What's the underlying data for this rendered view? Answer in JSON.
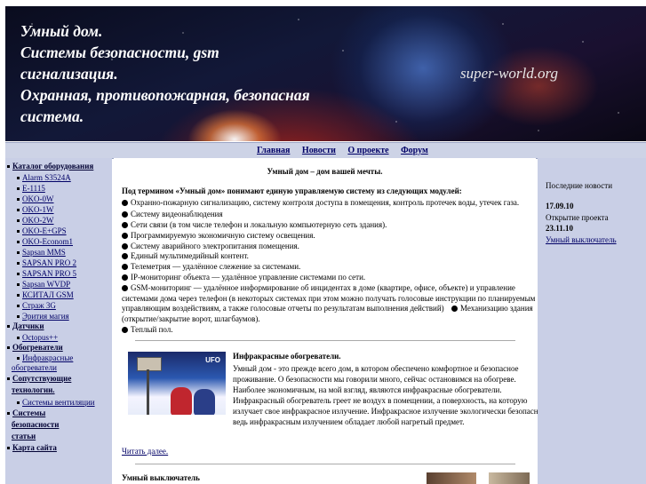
{
  "header": {
    "title_lines": [
      "Умный дом.",
      "Системы безопасности, gsm",
      "сигнализация.",
      "Охранная, противопожарная, безопасная",
      "система."
    ],
    "site": "super-world.org"
  },
  "nav": {
    "items": [
      "Главная",
      "Новости",
      "О проекте",
      "Форум"
    ]
  },
  "sidebar": {
    "catalog_title": "Каталог оборудования",
    "catalog_items": [
      "Alarm S3524A",
      "E-1115",
      "OKO-0W",
      "OKO-1W",
      "OKO-2W",
      "OKO-E+GPS",
      "OKO-Econom1",
      "Sapsan MMS",
      "SAPSAN PRO 2",
      "SAPSAN PRO 5",
      "Sapsan WVDP",
      "КСИТАЛ GSM",
      "Страж 3G",
      "Эрития магия"
    ],
    "sensors_title": "Датчики",
    "sensors_items": [
      "Octopus++"
    ],
    "heaters_title": "Обогреватели",
    "heaters_items": [
      "Инфракрасные",
      "обогреватели"
    ],
    "related_title": [
      "Сопутствующие",
      "технологии."
    ],
    "related_items": [
      "Системы вентиляции"
    ],
    "systems_title": [
      "Системы",
      "безопасности",
      "статьи"
    ],
    "sitemap": "Карта сайта"
  },
  "main": {
    "title": "Умный дом – дом вашей мечты.",
    "intro": "Под термином «Умный дом» понимают единую управляемую систему из следующих модулей:",
    "modules": [
      "Охранно-пожарную сигнализацию, систему контроля доступа в помещения, контроль протечек воды, утечек газа.",
      "Систему видеонаблюдения",
      "Сети связи (в том числе телефон и локальную компьютерную сеть здания).",
      "Программируемую экономичную систему освещения.",
      "Систему аварийного электропитания помещения.",
      "Единый мультимедийный контент.",
      "Телеметрия — удалённое слежение за системами.",
      "IP-мониторинг объекта — удалённое управление системами по сети.",
      "GSM-мониторинг — удалённое информирование об инцидентах в доме (квартире, офисе, объекте) и управление"
    ],
    "gsm_cont": [
      "системами дома через телефон (в некоторых системах при этом можно получать голосовые инструкции по планируемым",
      "управляющим воздействиям, а также голосовые отчеты по результатам выполнения действий)"
    ],
    "mech_item": "Механизацию здания",
    "mech_cont": "(открытие/закрытие ворот, шлагбаумов).",
    "last_item": "Теплый пол.",
    "photo_logo": "UFO",
    "ir_title": "Инфракрасные обогреватели.",
    "ir_text": [
      "Умный дом - это прежде всего дом, в котором обеспечено комфортное и безопасное",
      "проживание. О безопасности мы говорили много, сейчас остановимся на обогреве.",
      "Наиболее экономичным, на мой взгляд, являются инфракрасные обогреватели.",
      "Инфракрасный обогреватель греет не воздух в помещении, а поверхность, на которую",
      "излучает свое инфракрасное излучение. Инфракрасное излучение экологически безопасно",
      "ведь инфракрасным излучением обладает любой нагретый предмет."
    ],
    "read_more": "Читать далее.",
    "next_title": "Умный выключатель"
  },
  "right": {
    "news_title": "Последние новости",
    "date1": "17.09.10",
    "news1": "Открытие проекта",
    "date2": "23.11.10",
    "news2": "Умный выключатель"
  }
}
